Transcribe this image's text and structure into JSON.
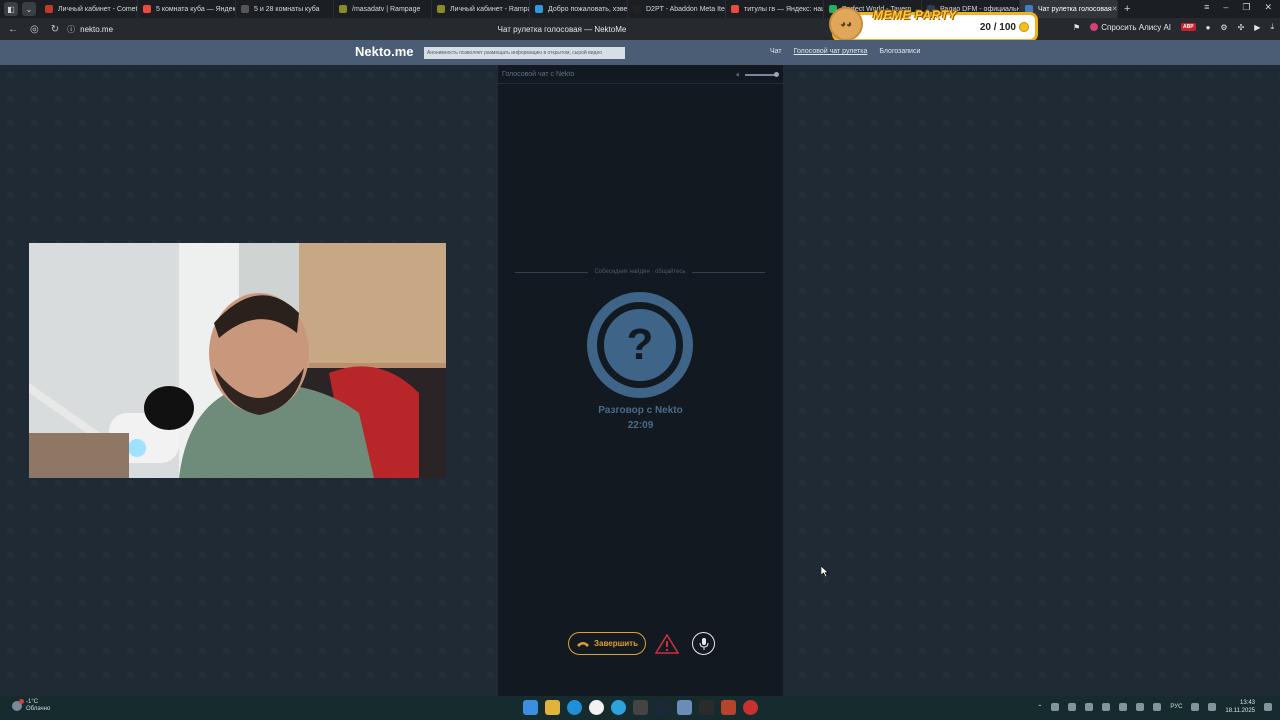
{
  "browser": {
    "tabs": [
      {
        "label": "Личный кабинет - Comet",
        "color": "#c0392b"
      },
      {
        "label": "5 комната куба — Яндекс",
        "color": "#e74c3c"
      },
      {
        "label": "5 и 28 комнаты куба",
        "color": "#555555"
      },
      {
        "label": "/masadatv | Rampage",
        "color": "#8a8a2a"
      },
      {
        "label": "Личный кабинет - Rampage",
        "color": "#8a8a2a"
      },
      {
        "label": "Добро пожаловать, хэвен",
        "color": "#3498db"
      },
      {
        "label": "D2PT - Abaddon Meta Items",
        "color": "#222222"
      },
      {
        "label": "титулы гв — Яндекс: нашлось",
        "color": "#e74c3c"
      },
      {
        "label": "Perfect World - Tavern",
        "color": "#27ae60"
      },
      {
        "label": "Радио DFM - официальный",
        "color": "#2c3e50"
      },
      {
        "label": "Чат рулетка голосовая",
        "color": "#3f7fbf"
      }
    ],
    "page_title": "Чат рулетка голосовая — NektoMe",
    "url": "nekto.me",
    "ask_alisa": "Спросить Алису AI",
    "abp_label": "ABP"
  },
  "overlay": {
    "title": "MEME PARTY",
    "score": "20 / 100"
  },
  "site": {
    "logo": "Nekto.me",
    "anon_notice": "Анонимность позволяет размещать информацию в открытом, сырой видео",
    "nav": [
      "Чат",
      "Голосовой чат рулетка",
      "Блогозаписи"
    ]
  },
  "chat": {
    "header": "Голосовой чат с Nekto",
    "found_text": "Собеседник найден · общайтесь",
    "avatar_symbol": "?",
    "talk_title": "Разговор с Nekto",
    "timer": "22:09",
    "end_button": "Завершить"
  },
  "taskbar": {
    "temperature": "-1°C",
    "weather": "Облачно",
    "lang": "РУС",
    "time": "13:43",
    "date": "18.11.2025"
  }
}
